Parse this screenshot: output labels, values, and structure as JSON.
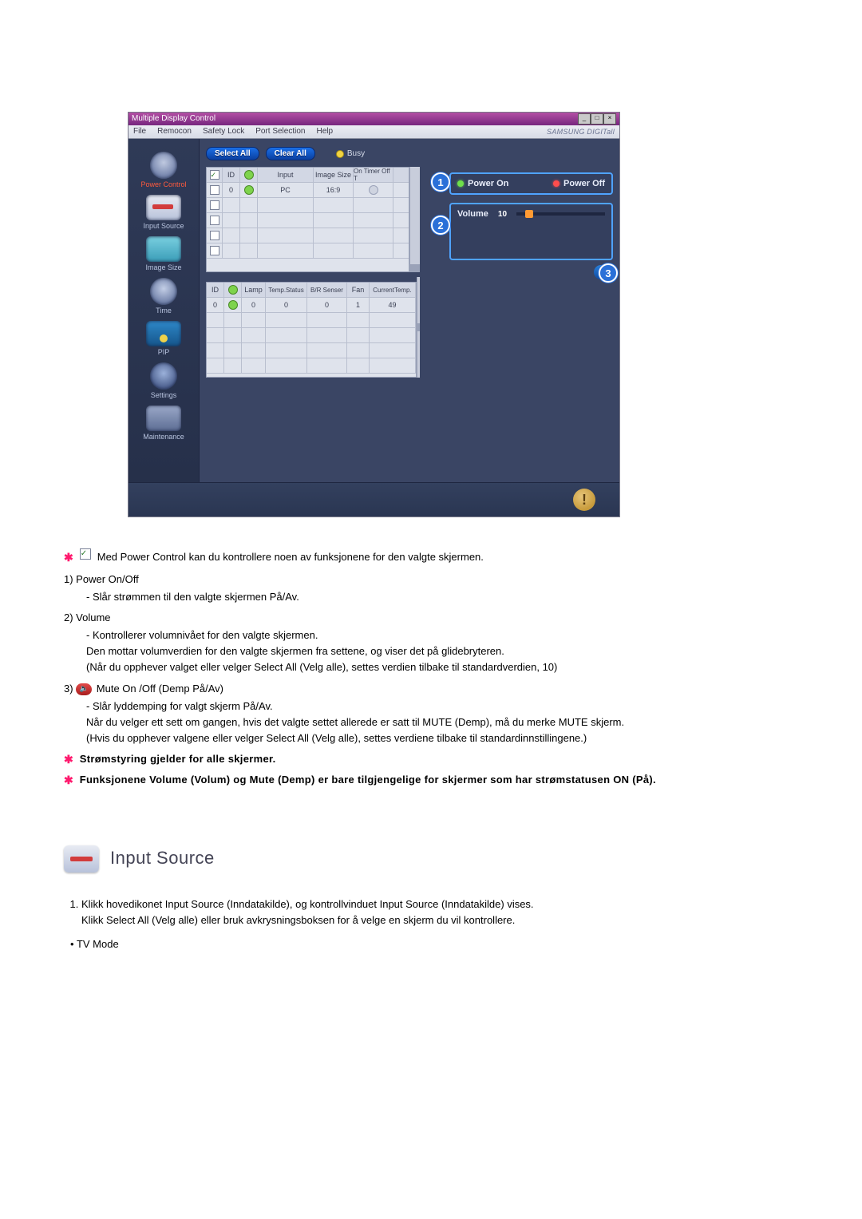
{
  "screenshot": {
    "title": "Multiple Display Control",
    "menus": [
      "File",
      "Remocon",
      "Safety Lock",
      "Port Selection",
      "Help"
    ],
    "brand": "SAMSUNG DIGITall",
    "sidebar": [
      {
        "label": "Power Control",
        "cls": "power",
        "labelClass": "red"
      },
      {
        "label": "Input Source",
        "cls": "input"
      },
      {
        "label": "Image Size",
        "cls": "imgsize"
      },
      {
        "label": "Time",
        "cls": "time"
      },
      {
        "label": "PIP",
        "cls": "pip"
      },
      {
        "label": "Settings",
        "cls": "settings"
      },
      {
        "label": "Maintenance",
        "cls": "maint"
      }
    ],
    "select_all": "Select All",
    "clear_all": "Clear All",
    "busy": "Busy",
    "grid_top_head": [
      "",
      "ID",
      "",
      "Input",
      "Image Size",
      "On Timer Off T"
    ],
    "grid_top_row": {
      "id": "0",
      "input": "PC",
      "image_size": "16:9"
    },
    "grid_bottom_head": [
      "ID",
      "",
      "Lamp",
      "Temp.Status",
      "B/R Senser",
      "Fan",
      "CurrentTemp."
    ],
    "grid_bottom_row": {
      "id": "0",
      "lamp": "0",
      "temp_status": "0",
      "br": "0",
      "fan": "1",
      "ct": "49"
    },
    "panel": {
      "power_on": "Power On",
      "power_off": "Power Off",
      "volume_label": "Volume",
      "volume_value": "10"
    },
    "callouts": {
      "c1": "1",
      "c2": "2",
      "c3": "3"
    }
  },
  "doc": {
    "intro": "Med Power Control kan du kontrollere noen av funksjonene for den valgte skjermen.",
    "i1_head": "1)  Power On/Off",
    "i1_a": "- Slår strømmen til den valgte skjermen På/Av.",
    "i2_head": "2)  Volume",
    "i2_a": "- Kontrollerer volumnivået for den valgte skjermen.",
    "i2_b": "Den mottar volumverdien for den valgte skjermen fra settene, og viser det på glidebryteren.",
    "i2_c": "(Når du opphever valget eller velger Select All (Velg alle), settes verdien tilbake til standardverdien, 10)",
    "i3_head_pre": "3)  ",
    "i3_head": "Mute On /Off (Demp På/Av)",
    "i3_a": "- Slår lyddemping for valgt skjerm På/Av.",
    "i3_b": "Når du velger ett sett om gangen, hvis det valgte settet allerede er satt til MUTE (Demp), må du merke MUTE skjerm.",
    "i3_c": "(Hvis du opphever valgene eller velger Select All (Velg alle), settes verdiene tilbake til standardinnstillingene.)",
    "note1": "Strømstyring gjelder for alle skjermer.",
    "note2": "Funksjonene Volume (Volum) og Mute (Demp) er bare tilgjengelige for skjermer som har strømstatusen ON (På).",
    "section_title": "Input Source",
    "ol1": "Klikk hovedikonet Input Source (Inndatakilde), og kontrollvinduet Input Source (Inndatakilde) vises.",
    "ol1b": "Klikk Select All (Velg alle) eller bruk avkrysningsboksen for å velge en skjerm du vil kontrollere.",
    "bul1": "TV Mode"
  }
}
